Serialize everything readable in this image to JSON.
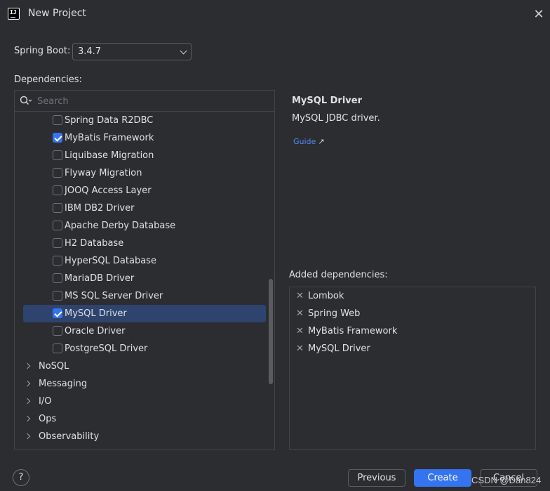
{
  "window": {
    "title": "New Project",
    "app_icon_text": "IJ"
  },
  "spring_boot": {
    "label": "Spring Boot:",
    "selected_version": "3.4.7"
  },
  "dependencies": {
    "label": "Dependencies:",
    "search_placeholder": "Search",
    "items": [
      {
        "label": "Spring Data R2DBC",
        "checked": false,
        "selected": false
      },
      {
        "label": "MyBatis Framework",
        "checked": true,
        "selected": false
      },
      {
        "label": "Liquibase Migration",
        "checked": false,
        "selected": false
      },
      {
        "label": "Flyway Migration",
        "checked": false,
        "selected": false
      },
      {
        "label": "JOOQ Access Layer",
        "checked": false,
        "selected": false
      },
      {
        "label": "IBM DB2 Driver",
        "checked": false,
        "selected": false
      },
      {
        "label": "Apache Derby Database",
        "checked": false,
        "selected": false
      },
      {
        "label": "H2 Database",
        "checked": false,
        "selected": false
      },
      {
        "label": "HyperSQL Database",
        "checked": false,
        "selected": false
      },
      {
        "label": "MariaDB Driver",
        "checked": false,
        "selected": false
      },
      {
        "label": "MS SQL Server Driver",
        "checked": false,
        "selected": false
      },
      {
        "label": "MySQL Driver",
        "checked": true,
        "selected": true
      },
      {
        "label": "Oracle Driver",
        "checked": false,
        "selected": false
      },
      {
        "label": "PostgreSQL Driver",
        "checked": false,
        "selected": false
      }
    ],
    "categories": [
      {
        "label": "NoSQL"
      },
      {
        "label": "Messaging"
      },
      {
        "label": "I/O"
      },
      {
        "label": "Ops"
      },
      {
        "label": "Observability"
      }
    ]
  },
  "details": {
    "title": "MySQL Driver",
    "description": "MySQL JDBC driver.",
    "guide_link": "Guide",
    "guide_link_icon": "↗"
  },
  "added": {
    "label": "Added dependencies:",
    "remove_icon": "✕",
    "items": [
      {
        "label": "Lombok"
      },
      {
        "label": "Spring Web"
      },
      {
        "label": "MyBatis Framework"
      },
      {
        "label": "MySQL Driver"
      }
    ]
  },
  "footer": {
    "help_label": "?",
    "previous_label": "Previous",
    "create_label": "Create",
    "cancel_label": "Cancel",
    "watermark": "CSDN @Dan824"
  },
  "colors": {
    "accent": "#3574f0",
    "selection": "#2e436e",
    "link": "#548af7",
    "background": "#2b2d30"
  }
}
